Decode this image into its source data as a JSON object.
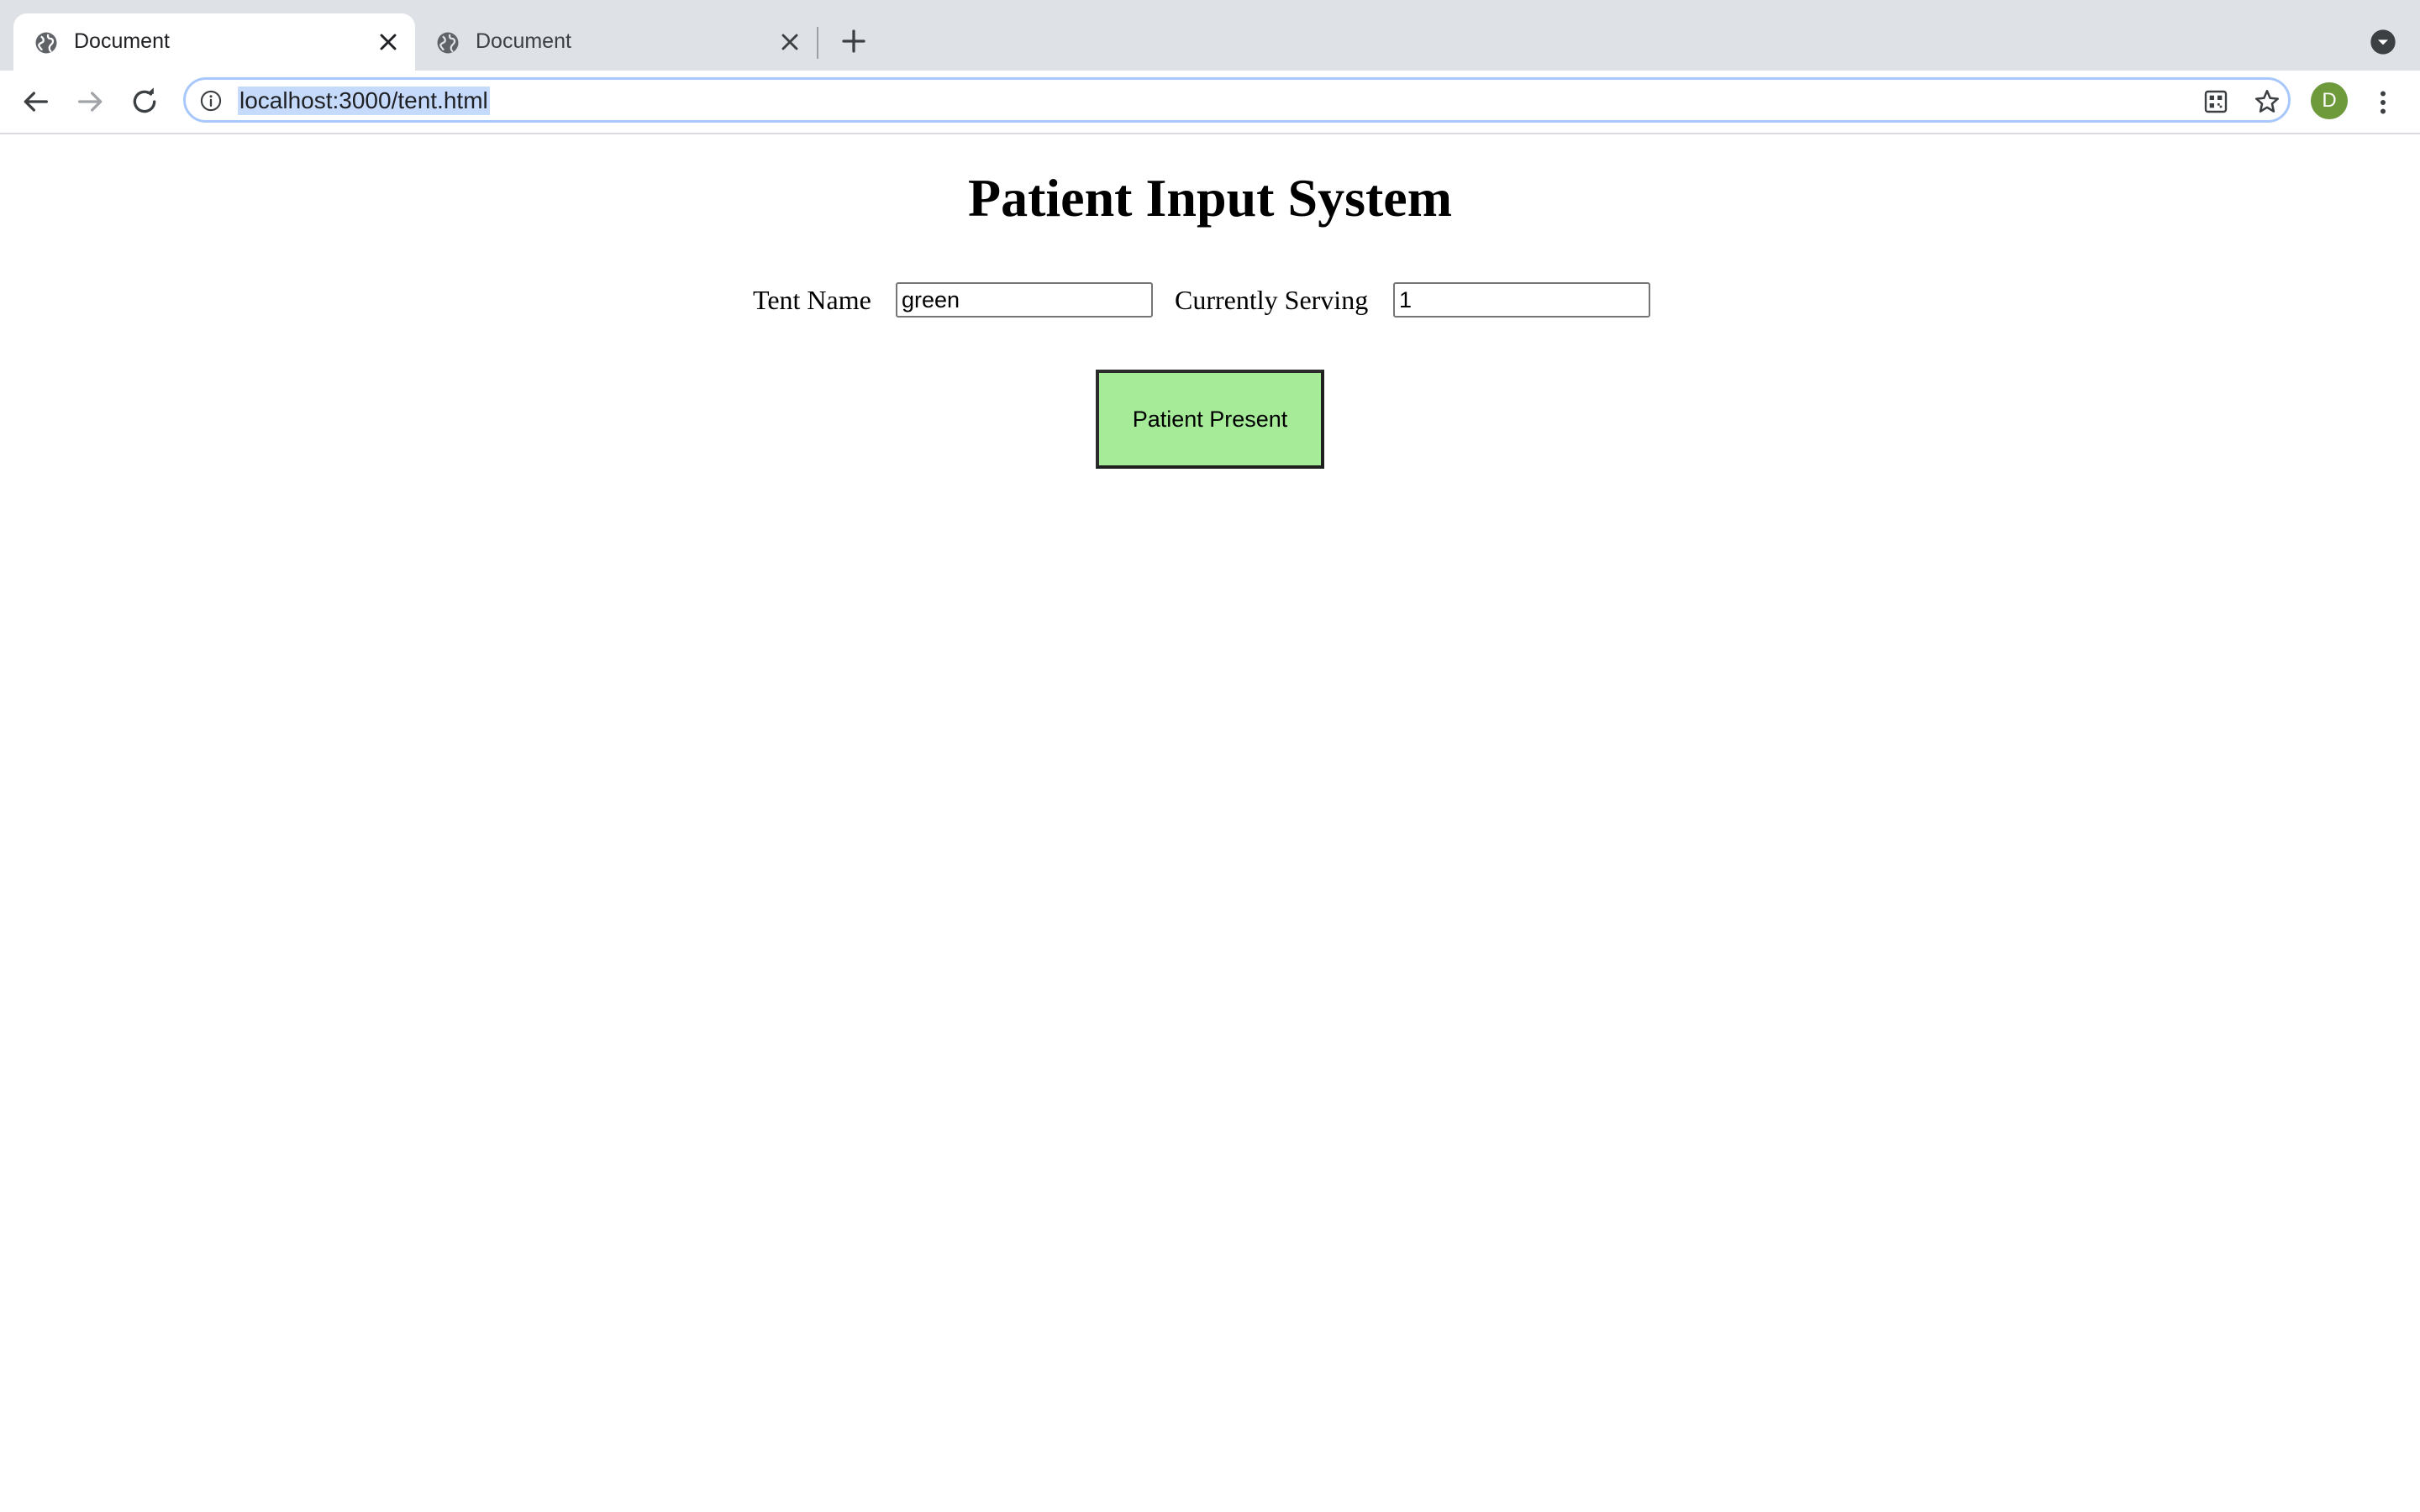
{
  "browser": {
    "tabs": [
      {
        "title": "Document",
        "active": true,
        "icon": "globe-icon"
      },
      {
        "title": "Document",
        "active": false,
        "icon": "globe-icon"
      }
    ],
    "address_bar": {
      "url": "localhost:3000/tent.html"
    },
    "profile": {
      "initial": "D",
      "color": "#6e9a3c"
    }
  },
  "page": {
    "title": "Patient Input System",
    "form": {
      "tent_name_label": "Tent Name",
      "tent_name_value": "green",
      "currently_serving_label": "Currently Serving",
      "currently_serving_value": "1"
    },
    "button": {
      "label": "Patient Present",
      "color": "#a5eb98"
    }
  }
}
